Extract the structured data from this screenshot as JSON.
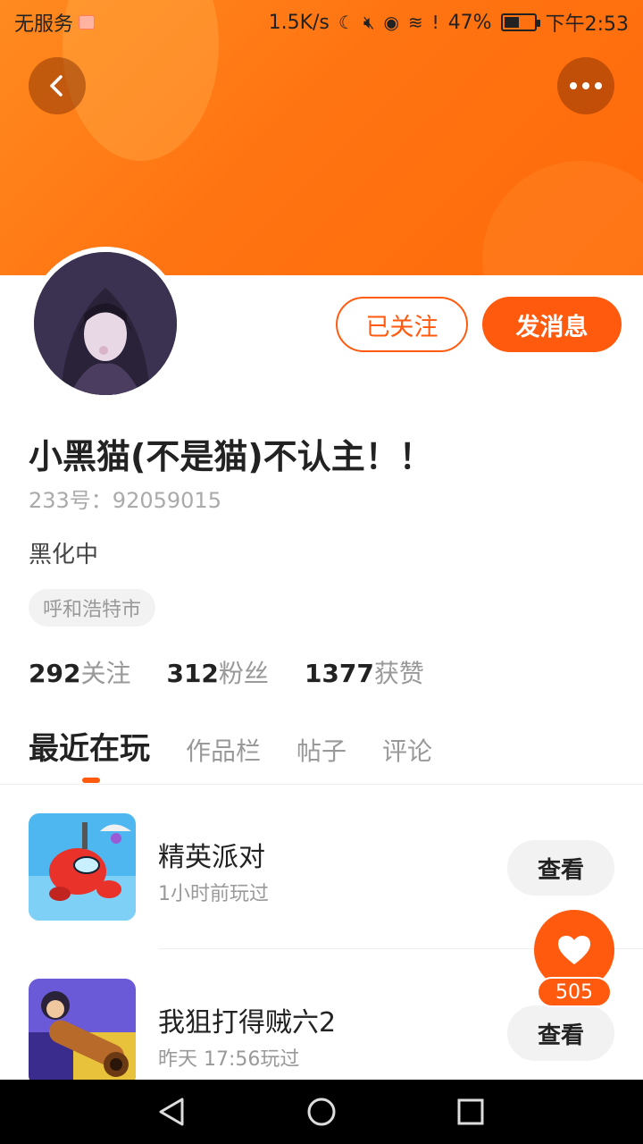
{
  "status_bar": {
    "carrier": "无服务",
    "speed": "1.5K/s",
    "battery": "47%",
    "battery_level": 0.47,
    "time": "下午2:53"
  },
  "header": {
    "back_icon": "chevron-left-icon",
    "more_icon": "more-dots-icon"
  },
  "profile": {
    "follow_label": "已关注",
    "message_label": "发消息",
    "username": "小黑猫(不是猫)不认主！！",
    "id_line": "233号：92059015",
    "bio": "黑化中",
    "location": "呼和浩特市"
  },
  "stats": [
    {
      "num": "292",
      "label": "关注"
    },
    {
      "num": "312",
      "label": "粉丝"
    },
    {
      "num": "1377",
      "label": "获赞"
    }
  ],
  "tabs": [
    "最近在玩",
    "作品栏",
    "帖子",
    "评论"
  ],
  "games": [
    {
      "name": "精英派对",
      "time": "1小时前玩过",
      "view_label": "查看"
    },
    {
      "name": "我狙打得贼六2",
      "time": "昨天 17:56玩过",
      "view_label": "查看"
    }
  ],
  "like": {
    "icon": "heart-icon",
    "count": "505"
  },
  "colors": {
    "accent": "#ff5a0e",
    "banner": "#ff7412"
  }
}
